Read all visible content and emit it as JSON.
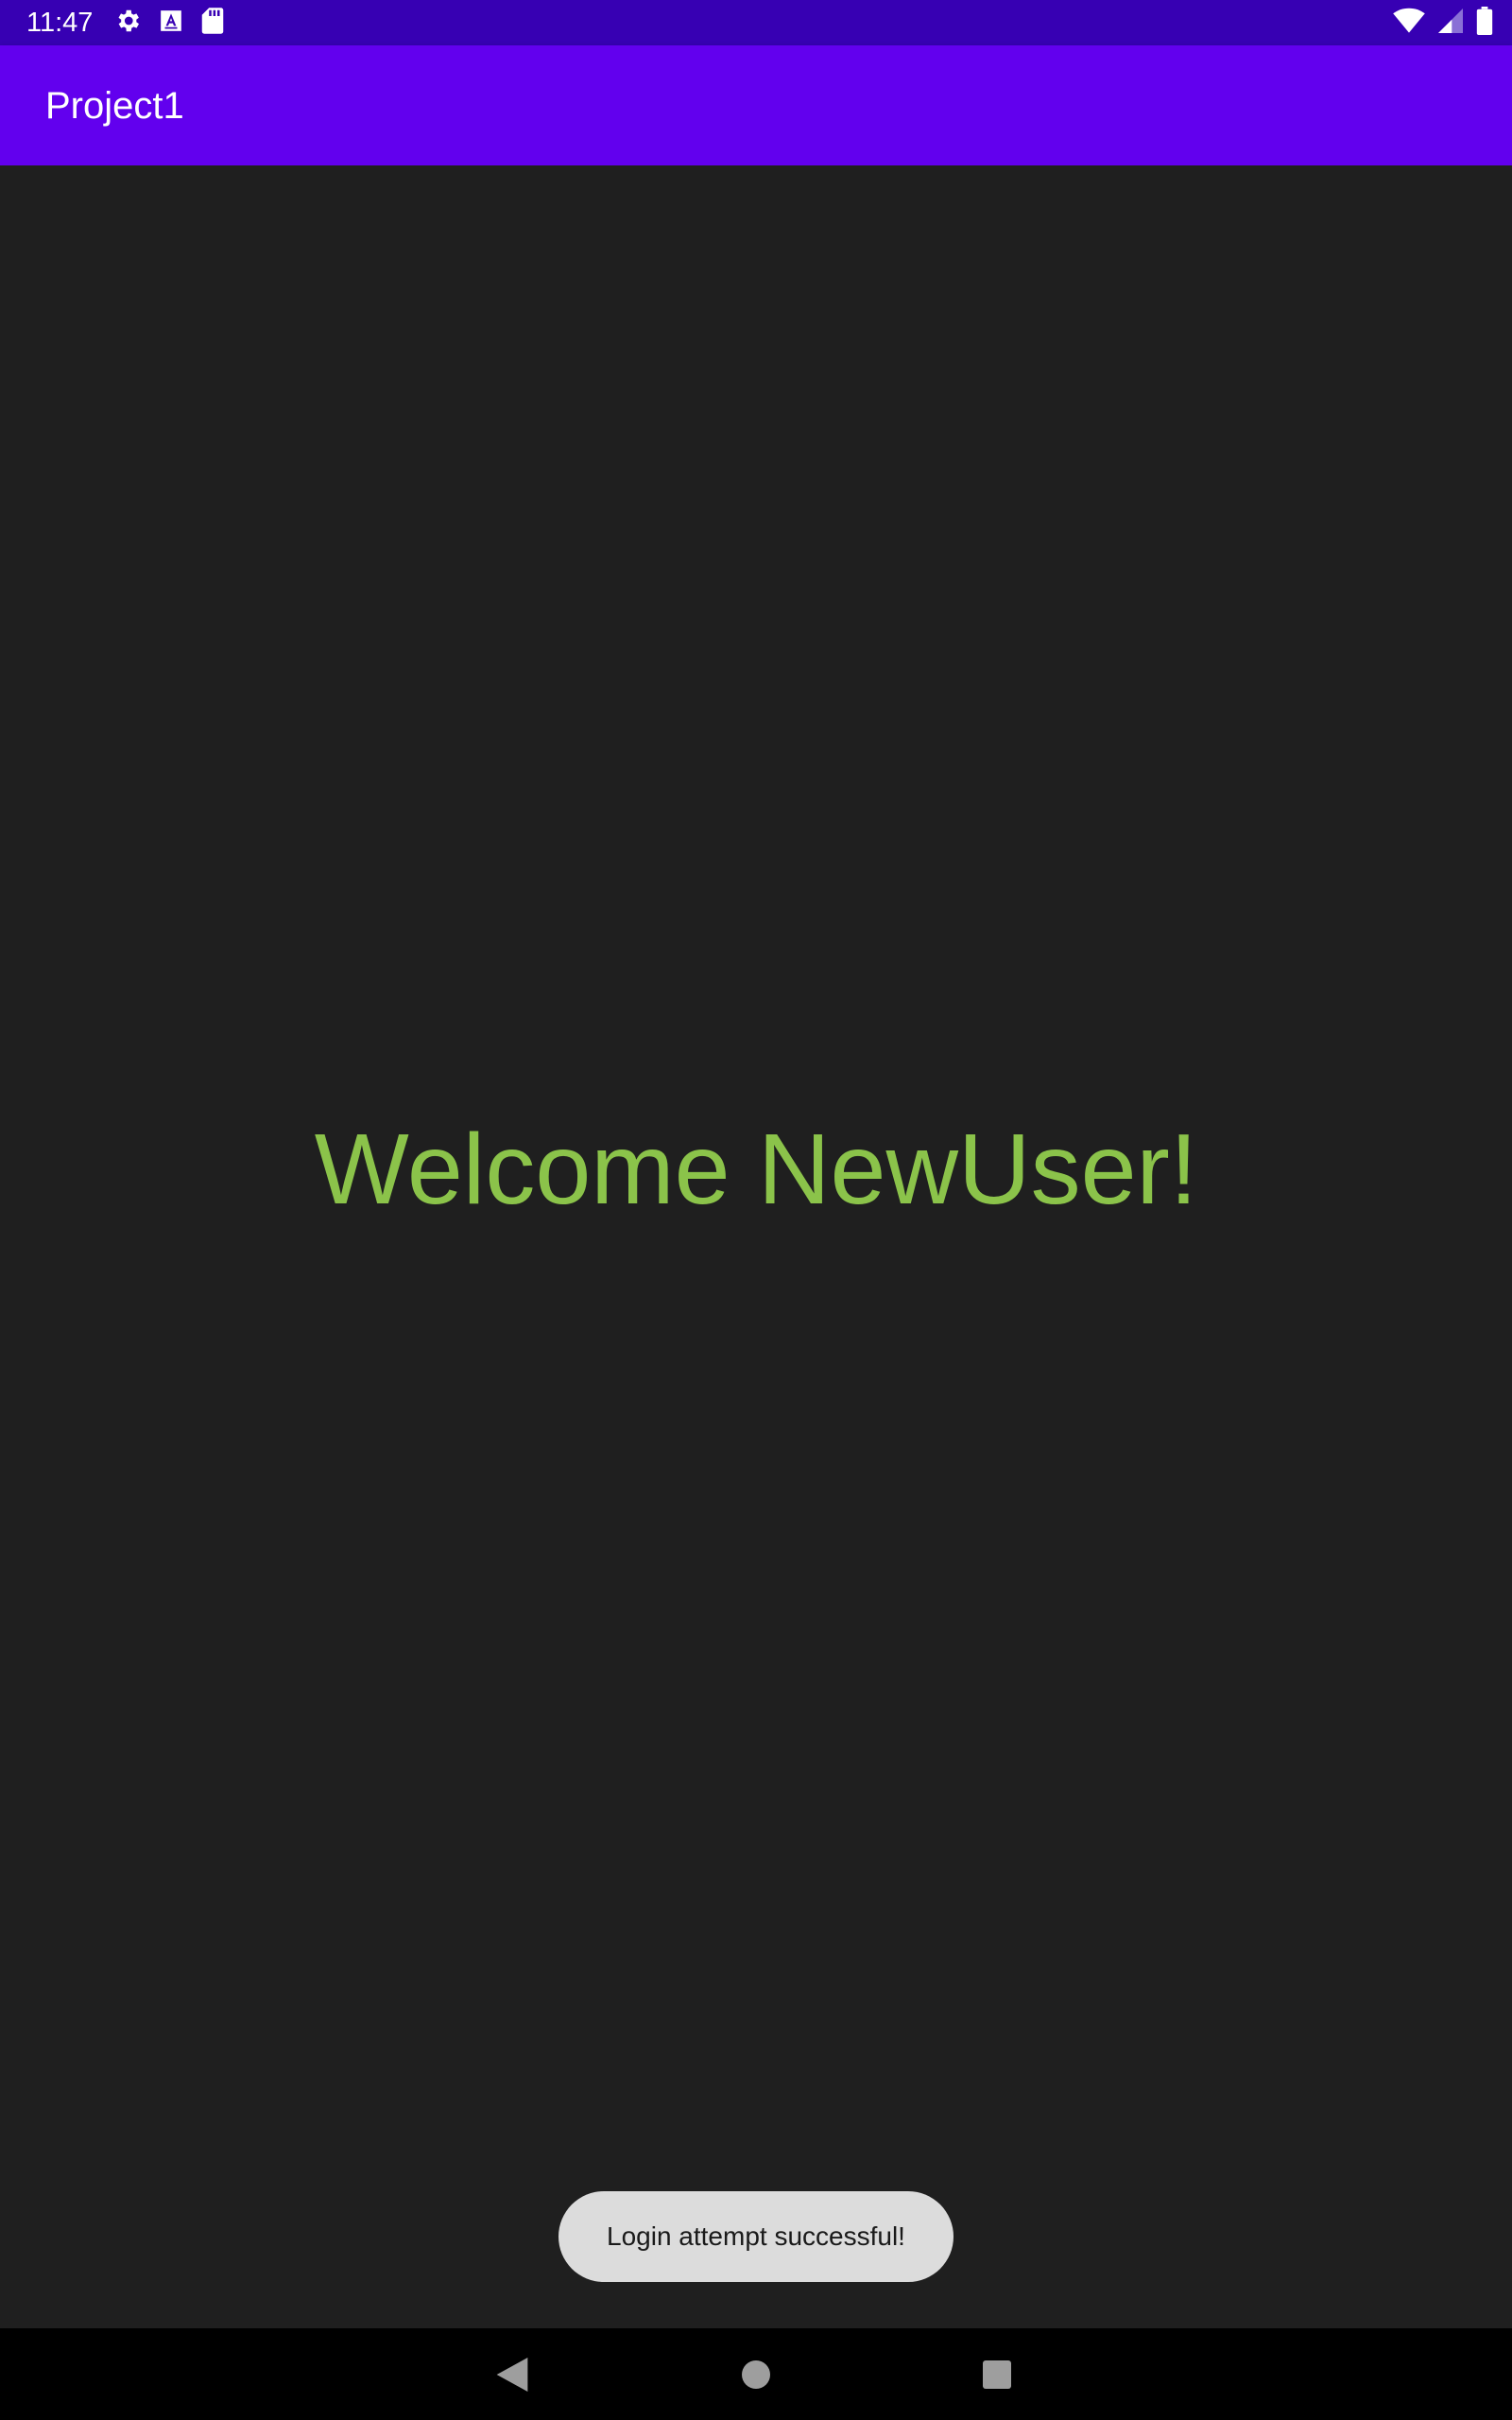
{
  "status_bar": {
    "time": "11:47",
    "left_icons": [
      "settings-icon",
      "text-a-icon",
      "sd-card-icon"
    ],
    "right_icons": [
      "wifi-icon",
      "cellular-signal-icon",
      "battery-icon"
    ],
    "background_color": "#3700b3"
  },
  "app_bar": {
    "title": "Project1",
    "background_color": "#6200ee"
  },
  "main": {
    "welcome_text": "Welcome NewUser!",
    "welcome_color": "#8bc34a",
    "background_color": "#1f1f1f"
  },
  "toast": {
    "message": "Login attempt successful!"
  },
  "nav_bar": {
    "buttons": [
      "back-icon",
      "home-icon",
      "recents-icon"
    ]
  }
}
